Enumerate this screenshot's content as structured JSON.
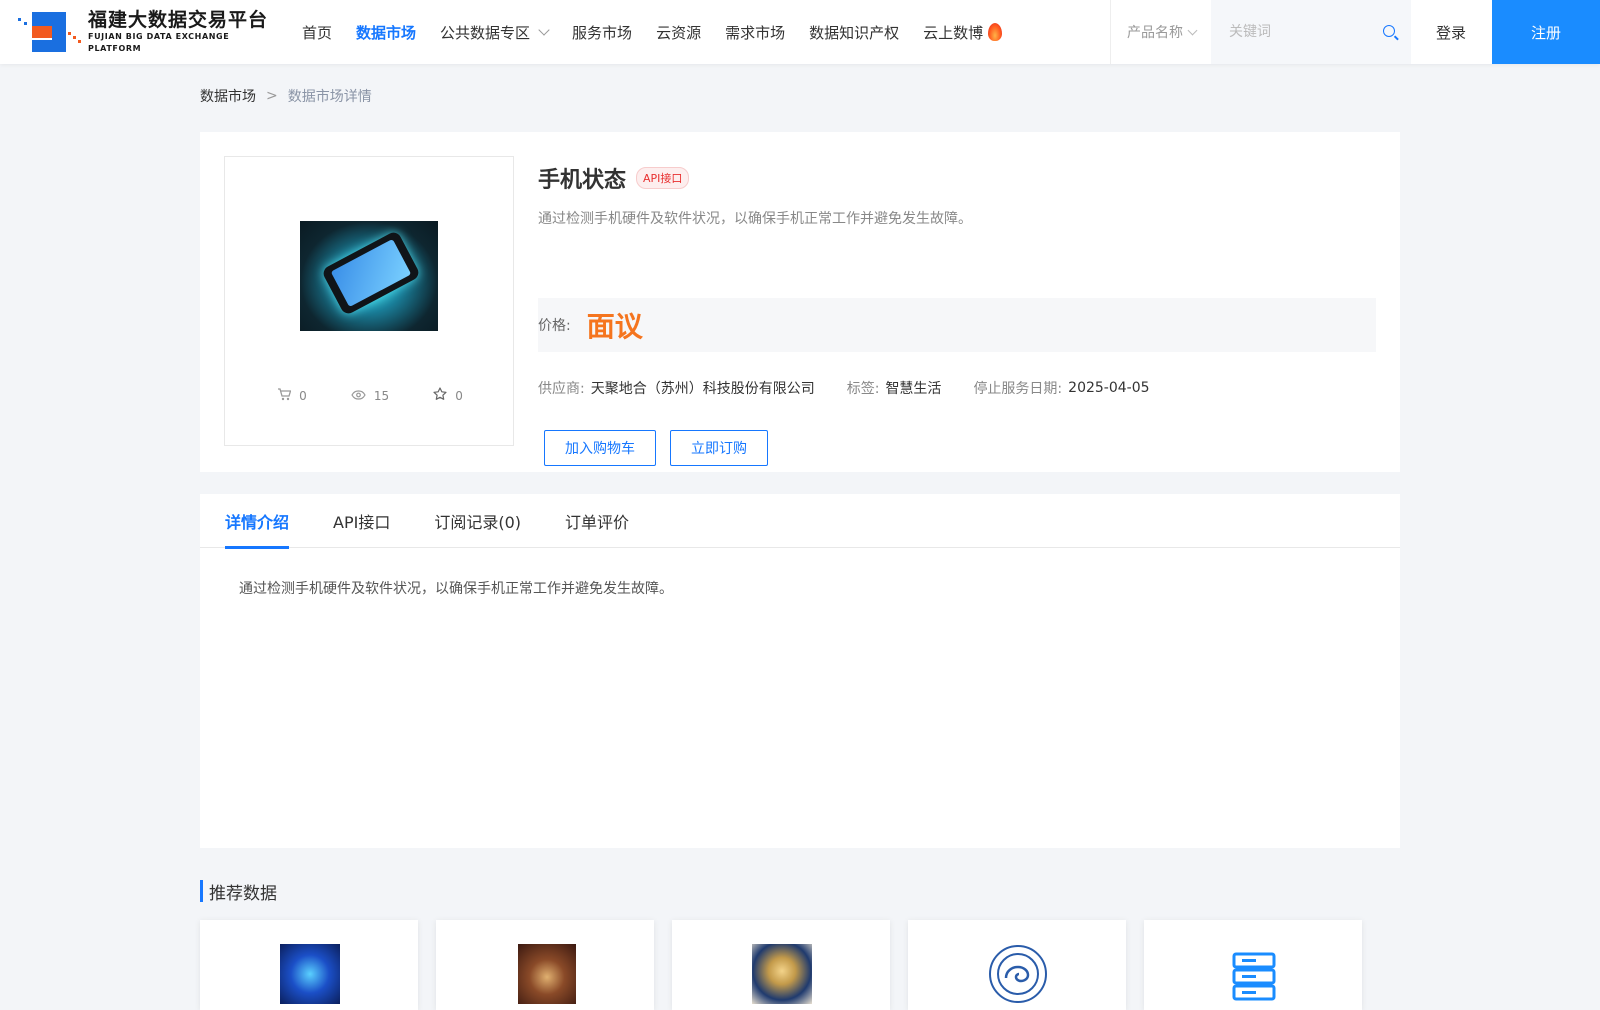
{
  "header": {
    "logo": {
      "cn": "福建大数据交易平台",
      "en": "FUJIAN BIG DATA EXCHANGE  PLATFORM"
    },
    "nav": [
      {
        "label": "首页"
      },
      {
        "label": "数据市场",
        "active": true
      },
      {
        "label": "公共数据专区",
        "dropdown": true
      },
      {
        "label": "服务市场"
      },
      {
        "label": "云资源"
      },
      {
        "label": "需求市场"
      },
      {
        "label": "数据知识产权"
      },
      {
        "label": "云上数博",
        "icon": "fire-icon"
      }
    ],
    "search": {
      "select_value": "产品名称",
      "placeholder": "关键词"
    },
    "login": "登录",
    "register": "注册",
    "accent": "#1677ff"
  },
  "breadcrumb": {
    "parent": "数据市场",
    "separator": ">",
    "current": "数据市场详情"
  },
  "product": {
    "title": "手机状态",
    "badge": "API接口",
    "description": "通过检测手机硬件及软件状况，以确保手机正常工作并避免发生故障。",
    "price_label": "价格:",
    "price_value": "面议",
    "price_color": "#f5751f",
    "supplier_label": "供应商:",
    "supplier": "天聚地合（苏州）科技股份有限公司",
    "tag_label": "标签:",
    "tag": "智慧生活",
    "end_date_label": "停止服务日期:",
    "end_date": "2025-04-05",
    "stats": {
      "cart": "0",
      "views": "15",
      "favorites": "0"
    },
    "buttons": {
      "add_cart": "加入购物车",
      "subscribe": "立即订购"
    }
  },
  "tabs": [
    {
      "label": "详情介绍",
      "active": true
    },
    {
      "label": "API接口"
    },
    {
      "label": "订阅记录(0)"
    },
    {
      "label": "订单评价"
    }
  ],
  "tab_content": "通过检测手机硬件及软件状况，以确保手机正常工作并避免发生故障。",
  "recommended": {
    "title": "推荐数据"
  }
}
